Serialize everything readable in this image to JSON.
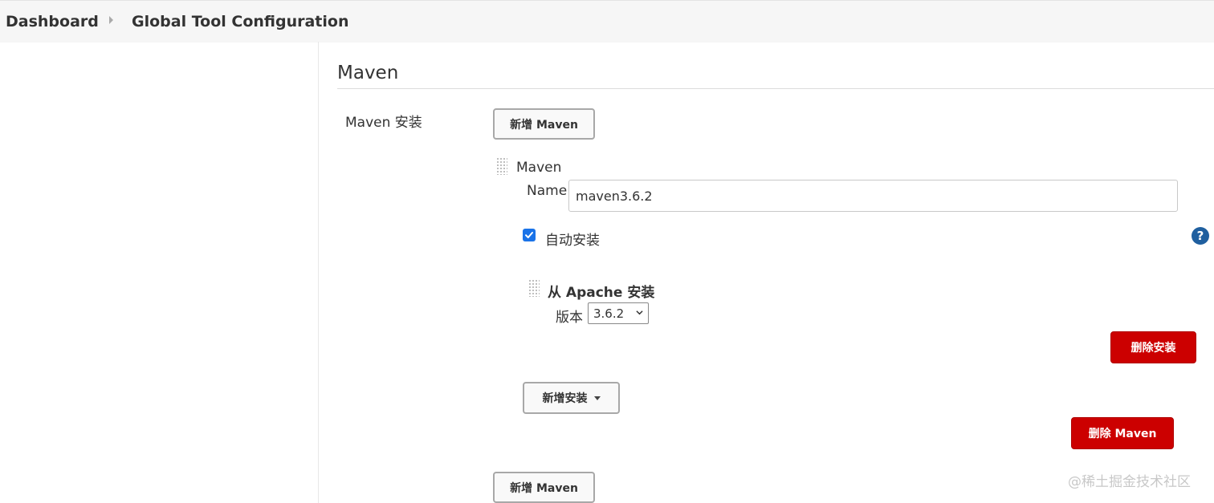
{
  "breadcrumb": {
    "items": [
      "Dashboard",
      "Global Tool Configuration"
    ]
  },
  "section": {
    "title": "Maven",
    "install_label": "Maven 安装",
    "add_maven_label": "新增 Maven",
    "add_maven_bottom_label": "新增 Maven"
  },
  "installation": {
    "header": "Maven",
    "name_label": "Name",
    "name_value": "maven3.6.2",
    "auto_install_label": "自动安装",
    "auto_install_checked": true,
    "help_glyph": "?",
    "installer": {
      "title": "从 Apache 安装",
      "version_label": "版本",
      "version_value": "3.6.2"
    },
    "delete_installer_label": "删除安装",
    "add_installer_label": "新增安装",
    "delete_maven_label": "删除 Maven"
  },
  "watermark": "@稀土掘金技术社区",
  "colors": {
    "danger": "#cc0000",
    "checkbox": "#1a73e8",
    "help": "#1f5f9f"
  },
  "icons": {
    "help": "question-circle-icon",
    "dropdown": "caret-down-icon",
    "drag": "drag-handle-icon"
  }
}
